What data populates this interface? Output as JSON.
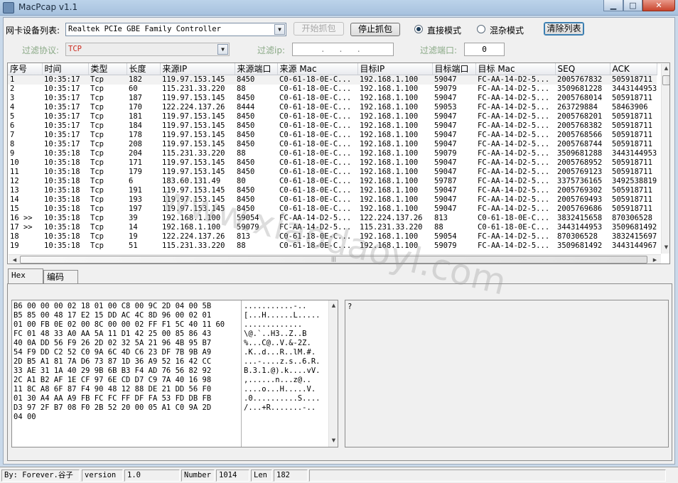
{
  "window": {
    "title": "MacPcap  v1.1",
    "min": "▁",
    "max": "□",
    "close": "✕"
  },
  "toolbar": {
    "nic_label": "网卡设备列表:",
    "nic_value": "Realtek PCIe GBE Family Controller",
    "start_label": "开始抓包",
    "stop_label": "停止抓包",
    "mode_direct": "直接模式",
    "mode_promisc": "混杂模式",
    "clear_label": "清除列表",
    "filter_proto_label": "过滤协议:",
    "filter_proto_value": "TCP",
    "filter_ip_label": "过滤ip:",
    "filter_ip_value": " .  .  . ",
    "filter_port_label": "过滤端口:",
    "filter_port_value": "0"
  },
  "packets": {
    "columns": [
      "序号",
      "时间",
      "类型",
      "长度",
      "来源IP",
      "来源端口",
      "来源 Mac",
      "目标IP",
      "目标端口",
      "目标 Mac",
      "SEQ",
      "ACK"
    ],
    "rows": [
      [
        "1",
        "10:35:17",
        "Tcp",
        "182",
        "119.97.153.145",
        "8450",
        "C0-61-18-0E-C...",
        "192.168.1.100",
        "59047",
        "FC-AA-14-D2-5...",
        "2005767832",
        "505918711"
      ],
      [
        "2",
        "10:35:17",
        "Tcp",
        "60",
        "115.231.33.220",
        "88",
        "C0-61-18-0E-C...",
        "192.168.1.100",
        "59079",
        "FC-AA-14-D2-5...",
        "3509681228",
        "3443144953"
      ],
      [
        "3",
        "10:35:17",
        "Tcp",
        "187",
        "119.97.153.145",
        "8450",
        "C0-61-18-0E-C...",
        "192.168.1.100",
        "59047",
        "FC-AA-14-D2-5...",
        "2005768014",
        "505918711"
      ],
      [
        "4",
        "10:35:17",
        "Tcp",
        "170",
        "122.224.137.26",
        "8444",
        "C0-61-18-0E-C...",
        "192.168.1.100",
        "59053",
        "FC-AA-14-D2-5...",
        "263729884",
        "58463906"
      ],
      [
        "5",
        "10:35:17",
        "Tcp",
        "181",
        "119.97.153.145",
        "8450",
        "C0-61-18-0E-C...",
        "192.168.1.100",
        "59047",
        "FC-AA-14-D2-5...",
        "2005768201",
        "505918711"
      ],
      [
        "6",
        "10:35:17",
        "Tcp",
        "184",
        "119.97.153.145",
        "8450",
        "C0-61-18-0E-C...",
        "192.168.1.100",
        "59047",
        "FC-AA-14-D2-5...",
        "2005768382",
        "505918711"
      ],
      [
        "7",
        "10:35:17",
        "Tcp",
        "178",
        "119.97.153.145",
        "8450",
        "C0-61-18-0E-C...",
        "192.168.1.100",
        "59047",
        "FC-AA-14-D2-5...",
        "2005768566",
        "505918711"
      ],
      [
        "8",
        "10:35:17",
        "Tcp",
        "208",
        "119.97.153.145",
        "8450",
        "C0-61-18-0E-C...",
        "192.168.1.100",
        "59047",
        "FC-AA-14-D2-5...",
        "2005768744",
        "505918711"
      ],
      [
        "9",
        "10:35:18",
        "Tcp",
        "204",
        "115.231.33.220",
        "88",
        "C0-61-18-0E-C...",
        "192.168.1.100",
        "59079",
        "FC-AA-14-D2-5...",
        "3509681288",
        "3443144953"
      ],
      [
        "10",
        "10:35:18",
        "Tcp",
        "171",
        "119.97.153.145",
        "8450",
        "C0-61-18-0E-C...",
        "192.168.1.100",
        "59047",
        "FC-AA-14-D2-5...",
        "2005768952",
        "505918711"
      ],
      [
        "11",
        "10:35:18",
        "Tcp",
        "179",
        "119.97.153.145",
        "8450",
        "C0-61-18-0E-C...",
        "192.168.1.100",
        "59047",
        "FC-AA-14-D2-5...",
        "2005769123",
        "505918711"
      ],
      [
        "12",
        "10:35:18",
        "Tcp",
        "6",
        "183.60.131.49",
        "80",
        "C0-61-18-0E-C...",
        "192.168.1.100",
        "59787",
        "FC-AA-14-D2-5...",
        "3375736165",
        "3492538819"
      ],
      [
        "13",
        "10:35:18",
        "Tcp",
        "191",
        "119.97.153.145",
        "8450",
        "C0-61-18-0E-C...",
        "192.168.1.100",
        "59047",
        "FC-AA-14-D2-5...",
        "2005769302",
        "505918711"
      ],
      [
        "14",
        "10:35:18",
        "Tcp",
        "193",
        "119.97.153.145",
        "8450",
        "C0-61-18-0E-C...",
        "192.168.1.100",
        "59047",
        "FC-AA-14-D2-5...",
        "2005769493",
        "505918711"
      ],
      [
        "15",
        "10:35:18",
        "Tcp",
        "197",
        "119.97.153.145",
        "8450",
        "C0-61-18-0E-C...",
        "192.168.1.100",
        "59047",
        "FC-AA-14-D2-5...",
        "2005769686",
        "505918711"
      ],
      [
        "16 >>",
        "10:35:18",
        "Tcp",
        "39",
        "192.168.1.100",
        "59054",
        "FC-AA-14-D2-5...",
        "122.224.137.26",
        "813",
        "C0-61-18-0E-C...",
        "3832415658",
        "870306528"
      ],
      [
        "17 >>",
        "10:35:18",
        "Tcp",
        "14",
        "192.168.1.100",
        "59079",
        "FC-AA-14-D2-5...",
        "115.231.33.220",
        "88",
        "C0-61-18-0E-C...",
        "3443144953",
        "3509681492"
      ],
      [
        "18",
        "10:35:18",
        "Tcp",
        "19",
        "122.224.137.26",
        "813",
        "C0-61-18-0E-C...",
        "192.168.1.100",
        "59054",
        "FC-AA-14-D2-5...",
        "870306528",
        "3832415697"
      ],
      [
        "19",
        "10:35:18",
        "Tcp",
        "51",
        "115.231.33.220",
        "88",
        "C0-61-18-0E-C...",
        "192.168.1.100",
        "59079",
        "FC-AA-14-D2-5...",
        "3509681492",
        "3443144967"
      ]
    ],
    "scroll_up": "▲",
    "scroll_down": "▼",
    "scroll_left": "◀",
    "scroll_right": "▶",
    "grip": "|||"
  },
  "tabs": {
    "hex": "Hex",
    "decode": "编码"
  },
  "hex": {
    "bytes": "B6 00 00 00 02 18 01 00 C8 00 9C 2D 04 00 5B\nB5 85 00 48 17 E2 15 DD AC 4C 8D 96 00 02 01\n01 00 FB 0E 02 00 8C 00 00 02 FF F1 5C 40 11 60\nFC 01 48 33 A0 AA 5A 11 D1 42 25 00 85 86 43\n40 0A DD 56 F9 26 2D 02 32 5A 21 96 4B 95 B7\n54 F9 DD C2 52 C0 9A 6C 4D C6 23 DF 7B 9B A9\n2D B5 A1 81 7A D6 73 87 1D 36 A9 52 16 42 CC\n33 AE 31 1A 40 29 9B 6B B3 F4 AD 76 56 82 92\n2C A1 B2 AF 1E CF 97 6E CD D7 C9 7A 40 16 98\n11 8C A8 6F 87 F4 90 48 12 88 DE 21 DD 56 F0\n01 30 A4 AA A9 FB FC FC FF DF FA 53 FD DB FB\nD3 97 2F B7 08 F0 2B 52 20 00 05 A1 C0 9A 2D\n04 00",
    "ascii": "...........-..\n[...H......L.....\n.............\n\\@.`..H3..Z..B\n%...C@..V.&-2Z.\n.K..d...R..lM.#.\n...-....z.s..6.R.\nB.3.1.@).k....vV.\n,......n...z@..\n....o...H.....V.\n.0..........S....\n/...+R.......-..\n",
    "detail": "?"
  },
  "status": {
    "author": "By: Forever.谷子",
    "version_label": "version",
    "version_value": "1.0",
    "number_label": "Number",
    "number_value": "1014",
    "len_label": "Len",
    "len_value": "182"
  },
  "watermark": "www.xiaodaoyl.com"
}
